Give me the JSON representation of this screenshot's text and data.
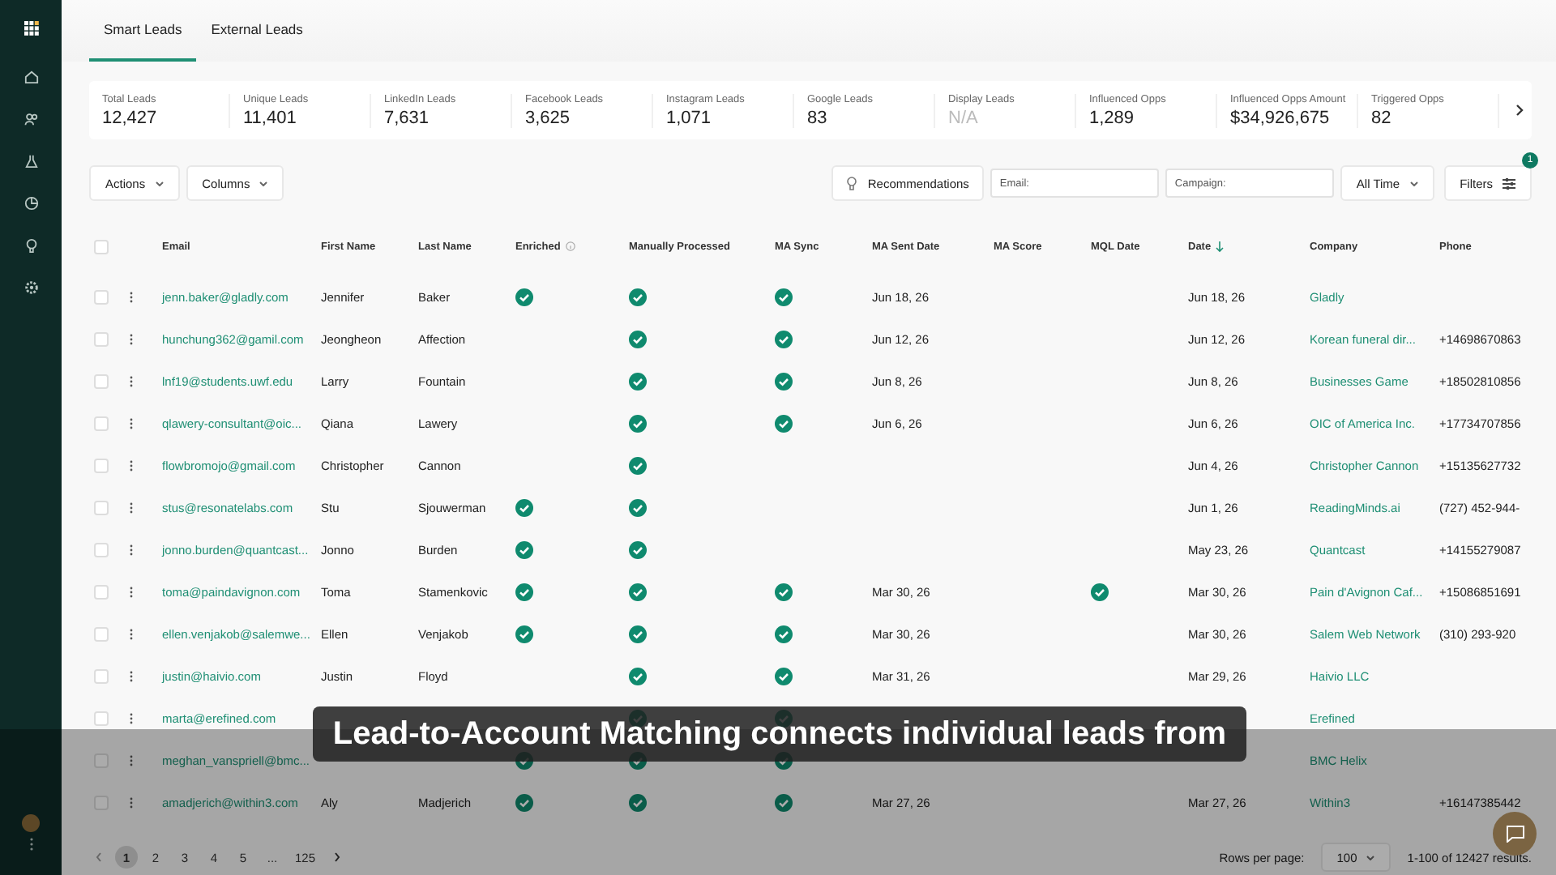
{
  "tabs": [
    {
      "label": "Smart Leads",
      "selected": true
    },
    {
      "label": "External Leads",
      "selected": false
    }
  ],
  "stats": [
    {
      "label": "Total Leads",
      "value": "12,427",
      "disabled": false
    },
    {
      "label": "Unique Leads",
      "value": "11,401",
      "disabled": false
    },
    {
      "label": "LinkedIn Leads",
      "value": "7,631",
      "disabled": false
    },
    {
      "label": "Facebook Leads",
      "value": "3,625",
      "disabled": false
    },
    {
      "label": "Instagram Leads",
      "value": "1,071",
      "disabled": false
    },
    {
      "label": "Google Leads",
      "value": "83",
      "disabled": false
    },
    {
      "label": "Display Leads",
      "value": "N/A",
      "disabled": true
    },
    {
      "label": "Influenced Opps",
      "value": "1,289",
      "disabled": false
    },
    {
      "label": "Influenced Opps Amount",
      "value": "$34,926,675",
      "disabled": false
    },
    {
      "label": "Triggered Opps",
      "value": "82",
      "disabled": false
    }
  ],
  "toolbar": {
    "actions": "Actions",
    "columns": "Columns",
    "recommendations": "Recommendations",
    "email": {
      "placeholder": "Email:"
    },
    "campaign": {
      "placeholder": "Campaign:"
    },
    "time": "All Time",
    "filters": "Filters",
    "filter_count": "1"
  },
  "table": {
    "all_checked": false,
    "columns": [
      {
        "label": "Email",
        "kind": "plain"
      },
      {
        "label": "First Name",
        "kind": "plain"
      },
      {
        "label": "Last Name",
        "kind": "plain"
      },
      {
        "label": "Enriched",
        "kind": "info"
      },
      {
        "label": "Manually Processed",
        "kind": "plain"
      },
      {
        "label": "MA Sync",
        "kind": "plain"
      },
      {
        "label": "MA Sent Date",
        "kind": "plain"
      },
      {
        "label": "MA Score",
        "kind": "plain"
      },
      {
        "label": "MQL Date",
        "kind": "plain"
      },
      {
        "label": "Date",
        "kind": "sorted"
      },
      {
        "label": "Company",
        "kind": "plain"
      },
      {
        "label": "Phone",
        "kind": "plain"
      }
    ],
    "rows": [
      {
        "checked": false,
        "email": "jenn.baker@gladly.com",
        "first_name": "Jennifer",
        "last_name": "Baker",
        "enriched": true,
        "manually_processed": true,
        "ma_sync": true,
        "ma_sent_date": "Jun 18, 26",
        "mql": false,
        "date": "Jun 18, 26",
        "company": "Gladly"
      },
      {
        "checked": false,
        "email": "hunchung362@gamil.com",
        "first_name": "Jeongheon",
        "last_name": "Affection",
        "enriched": false,
        "manually_processed": true,
        "ma_sync": true,
        "ma_sent_date": "Jun 12, 26",
        "mql": false,
        "date": "Jun 12, 26",
        "company": "Korean funeral dir...",
        "phone": "+14698670863"
      },
      {
        "checked": false,
        "email": "lnf19@students.uwf.edu",
        "first_name": "Larry",
        "last_name": "Fountain",
        "enriched": false,
        "manually_processed": true,
        "ma_sync": true,
        "ma_sent_date": "Jun 8, 26",
        "mql": false,
        "date": "Jun 8, 26",
        "company": "Businesses Game",
        "phone": "+18502810856"
      },
      {
        "checked": false,
        "email": "qlawery-consultant@oic...",
        "first_name": "Qiana",
        "last_name": "Lawery",
        "enriched": false,
        "manually_processed": true,
        "ma_sync": true,
        "ma_sent_date": "Jun 6, 26",
        "mql": false,
        "date": "Jun 6, 26",
        "company": "OIC of America Inc.",
        "phone": "+17734707856"
      },
      {
        "checked": false,
        "email": "flowbromojo@gmail.com",
        "first_name": "Christopher",
        "last_name": "Cannon",
        "enriched": false,
        "manually_processed": true,
        "ma_sync": false,
        "mql": false,
        "date": "Jun 4, 26",
        "company": "Christopher Cannon",
        "phone": "+15135627732"
      },
      {
        "checked": false,
        "email": "stus@resonatelabs.com",
        "first_name": "Stu",
        "last_name": "Sjouwerman",
        "enriched": true,
        "manually_processed": true,
        "ma_sync": false,
        "mql": false,
        "date": "Jun 1, 26",
        "company": "ReadingMinds.ai",
        "phone": "(727) 452-944-"
      },
      {
        "checked": false,
        "email": "jonno.burden@quantcast...",
        "first_name": "Jonno",
        "last_name": "Burden",
        "enriched": true,
        "manually_processed": true,
        "ma_sync": false,
        "mql": false,
        "date": "May 23, 26",
        "company": "Quantcast",
        "phone": "+14155279087"
      },
      {
        "checked": false,
        "email": "toma@paindavignon.com",
        "first_name": "Toma",
        "last_name": "Stamenkovic",
        "enriched": true,
        "manually_processed": true,
        "ma_sync": true,
        "ma_sent_date": "Mar 30, 26",
        "mql": true,
        "date": "Mar 30, 26",
        "company": "Pain d'Avignon Caf...",
        "phone": "+15086851691"
      },
      {
        "checked": false,
        "email": "ellen.venjakob@salemwe...",
        "first_name": "Ellen",
        "last_name": "Venjakob",
        "enriched": true,
        "manually_processed": true,
        "ma_sync": true,
        "ma_sent_date": "Mar 30, 26",
        "mql": false,
        "date": "Mar 30, 26",
        "company": "Salem Web Network",
        "phone": "(310) 293-920"
      },
      {
        "checked": false,
        "email": "justin@haivio.com",
        "first_name": "Justin",
        "last_name": "Floyd",
        "enriched": false,
        "manually_processed": true,
        "ma_sync": true,
        "ma_sent_date": "Mar 31, 26",
        "mql": false,
        "date": "Mar 29, 26",
        "company": "Haivio LLC"
      },
      {
        "checked": false,
        "email": "marta@erefined.com",
        "enriched": false,
        "manually_processed": true,
        "ma_sync": true,
        "mql": false,
        "company": "Erefined"
      },
      {
        "checked": false,
        "email": "meghan_vanspriell@bmc...",
        "enriched": true,
        "manually_processed": true,
        "ma_sync": true,
        "mql": false,
        "company": "BMC Helix"
      },
      {
        "checked": false,
        "email": "amadjerich@within3.com",
        "first_name": "Aly",
        "last_name": "Madjerich",
        "enriched": true,
        "manually_processed": true,
        "ma_sync": true,
        "ma_sent_date": "Mar 27, 26",
        "mql": false,
        "date": "Mar 27, 26",
        "company": "Within3",
        "phone": "+16147385442"
      }
    ]
  },
  "pagination": {
    "pages": [
      {
        "label": "1",
        "selected": true
      },
      {
        "label": "2",
        "selected": false
      },
      {
        "label": "3",
        "selected": false
      },
      {
        "label": "4",
        "selected": false
      },
      {
        "label": "5",
        "selected": false
      },
      {
        "label": "...",
        "selected": false
      },
      {
        "label": "125",
        "selected": false
      }
    ],
    "rows_per_page_label": "Rows per page:",
    "rows_per_page": "100",
    "results": "1-100 of 12427 results."
  },
  "caption": "Lead-to-Account Matching connects individual leads from"
}
